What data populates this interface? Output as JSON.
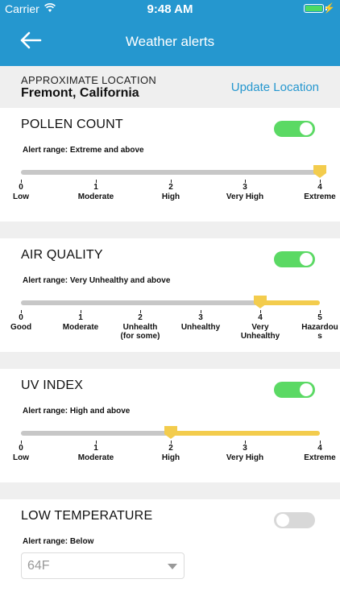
{
  "status": {
    "carrier": "Carrier",
    "time": "9:48 AM"
  },
  "header": {
    "title": "Weather alerts"
  },
  "location": {
    "label": "APPROXIMATE LOCATION",
    "city": "Fremont, California",
    "update_label": "Update Location"
  },
  "pollen": {
    "title": "POLLEN COUNT",
    "enabled": true,
    "range": "Alert range: Extreme and above",
    "value": 4,
    "ticks": [
      {
        "num": "0",
        "label": "Low"
      },
      {
        "num": "1",
        "label": "Moderate"
      },
      {
        "num": "2",
        "label": "High"
      },
      {
        "num": "3",
        "label": "Very High"
      },
      {
        "num": "4",
        "label": "Extreme"
      }
    ]
  },
  "air": {
    "title": "AIR QUALITY",
    "enabled": true,
    "range": "Alert range: Very Unhealthy and above",
    "value": 4,
    "ticks": [
      {
        "num": "0",
        "label": "Good"
      },
      {
        "num": "1",
        "label": "Moderate"
      },
      {
        "num": "2",
        "label": "Unhealth (for some)"
      },
      {
        "num": "3",
        "label": "Unhealthy"
      },
      {
        "num": "4",
        "label": "Very Unhealthy"
      },
      {
        "num": "5",
        "label": "Hazardous"
      }
    ]
  },
  "uv": {
    "title": "UV INDEX",
    "enabled": true,
    "range": "Alert range: High and above",
    "value": 2,
    "ticks": [
      {
        "num": "0",
        "label": "Low"
      },
      {
        "num": "1",
        "label": "Moderate"
      },
      {
        "num": "2",
        "label": "High"
      },
      {
        "num": "3",
        "label": "Very High"
      },
      {
        "num": "4",
        "label": "Extreme"
      }
    ]
  },
  "lowtemp": {
    "title": "LOW TEMPERATURE",
    "enabled": false,
    "range": "Alert range: Below",
    "selected": "64F"
  },
  "colors": {
    "header": "#2597cf",
    "toggle_on": "#5bd964",
    "slider_active": "#f3cc4d",
    "slider_inactive": "#c7c7c7"
  },
  "icons": [
    "wifi-icon",
    "battery-icon",
    "charging-icon",
    "back-arrow-icon",
    "chevron-down-icon"
  ]
}
